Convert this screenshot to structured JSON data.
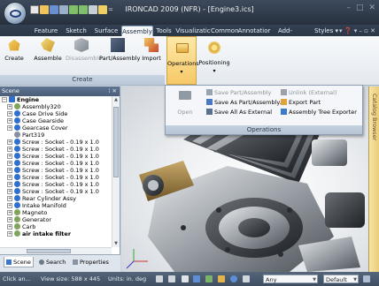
{
  "window": {
    "title": "IRONCAD 2009 (NFR) - [Engine3.ics]",
    "controls": [
      "–",
      "□",
      "✕"
    ]
  },
  "tabs": {
    "items": [
      "Feature",
      "Sketch",
      "Surface",
      "Assembly",
      "Tools",
      "Visualizatic",
      "Common",
      "Annotatior",
      "Add-Ins"
    ],
    "active": "Assembly",
    "styles_label": "Styles",
    "right_controls": "▾ ❓ ▾ – ▫ ✕"
  },
  "ribbon": {
    "buttons": {
      "create": "Create",
      "assemble": "Assemble",
      "disassemble": "Disassemble",
      "part_assembly": "Part/Assembly",
      "import": "Import",
      "operations": "Operations",
      "positioning": "Positioning"
    },
    "group_label": "Create"
  },
  "operations_menu": {
    "open": "Open",
    "save_part_assembly": "Save Part/Assembly",
    "save_as_part_assembly": "Save As Part/Assembly...",
    "save_all_as_external": "Save All As External",
    "unlink_external": "Unlink (External)",
    "export_part": "Export Part",
    "assembly_tree_exporter": "Assembly Tree Exporter",
    "label": "Operations"
  },
  "scene": {
    "title": "Scene",
    "controls": "ⵂ ✕",
    "root": "Engine",
    "items": [
      "Assembly320",
      "Case Drive Side",
      "Case Gearside",
      "Gearcase Cover",
      "Part319",
      "Screw : Socket - 0.19 x 1.0",
      "Screw : Socket - 0.19 x 1.0",
      "Screw : Socket - 0.19 x 1.0",
      "Screw : Socket - 0.19 x 1.0",
      "Screw : Socket - 0.19 x 1.0",
      "Screw : Socket - 0.19 x 1.0",
      "Screw : Socket - 0.19 x 1.0",
      "Screw : Socket - 0.19 x 1.0",
      "Rear Cylinder Assy",
      "Intake Manifold",
      "Magneto",
      "Generator",
      "Carb",
      "air intake filter"
    ],
    "tabs": [
      "Scene",
      "Search",
      "Properties"
    ]
  },
  "catalog_browser": "Catalog Browser",
  "status": {
    "hint": "Click an...",
    "view_size": "View size: 588 x 445",
    "units": "Units: in. deg",
    "filter": "Any",
    "style": "Default"
  },
  "colors": {
    "ribbon_active": "#f7c867",
    "titlebar": "#2f3a49",
    "statusbar": "#4a596d"
  }
}
